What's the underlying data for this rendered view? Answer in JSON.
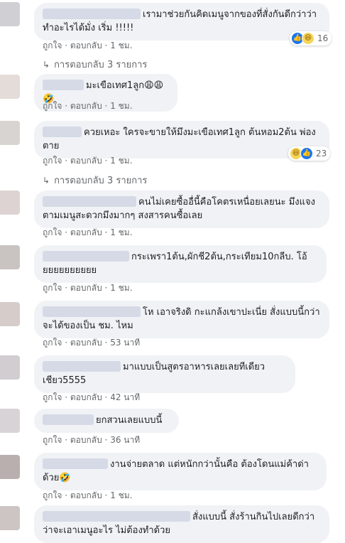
{
  "comments": [
    {
      "text": "เรามาช่วยกันคิดเมนูจากของที่สั่งกันดีกว่าว่าทำอะไรได้มั่ง เริ่ม !!!!!",
      "actions": {
        "like": "ถูกใจ",
        "reply": "ตอบกลับ",
        "time": "1 ชม."
      },
      "reactions": {
        "count": "16",
        "icons": [
          "like-icon",
          "haha-icon"
        ]
      },
      "replies_link": "การตอบกลับ 3 รายการ"
    },
    {
      "text": "มะเขือเทศ1ลูก",
      "emoji": "😩😩🤣",
      "actions": {
        "like": "ถูกใจ",
        "reply": "ตอบกลับ",
        "time": "1 ชม."
      }
    },
    {
      "text": "ควยเหอะ ใครจะขายให้มึงมะเขือเทศ1ลูก ต้นหอม2ต้น พ่องตาย",
      "actions": {
        "like": "ถูกใจ",
        "reply": "ตอบกลับ",
        "time": "1 ชม."
      },
      "reactions": {
        "count": "23",
        "icons": [
          "haha-icon",
          "like-icon"
        ]
      },
      "replies_link": "การตอบกลับ 3 รายการ"
    },
    {
      "text": "คนไม่เคยซื้ออื่นี้คือโคตรเหนื่อยเลยนะ มึงแจงตามเมนูสะดวกมึงมากๆ สงสารคนซื้อเลย",
      "actions": {
        "like": "ถูกใจ",
        "reply": "ตอบกลับ",
        "time": "1 ชม."
      }
    },
    {
      "text": "กระเพรา1ต้น,ผักชี2ต้น,กระเทียม10กลีบ. โอ้ยยยยยยยยยย",
      "actions": {
        "like": "ถูกใจ",
        "reply": "ตอบกลับ",
        "time": "1 ชม."
      }
    },
    {
      "text": "โห เอาจริงดิ กะแกล้งเขาปะเนี่ย สั่งแบบนี้กว่าจะได้ของเป็น ชม. ไหม",
      "actions": {
        "like": "ถูกใจ",
        "reply": "ตอบกลับ",
        "time": "53 นาที"
      }
    },
    {
      "text": "มาแบบเป็นสูตรอาหารเลยเลยทีเดียว เชียว5555",
      "actions": {
        "like": "ถูกใจ",
        "reply": "ตอบกลับ",
        "time": "42 นาที"
      }
    },
    {
      "text": "ยกสวนเลยแบบนี้",
      "actions": {
        "like": "ถูกใจ",
        "reply": "ตอบกลับ",
        "time": "36 นาที"
      }
    },
    {
      "text": "งานจ่ายตลาด แต่หนักกว่านั้นคือ ต้องโดนแม่ค้าด่าด้วย",
      "emoji": "🤣",
      "actions": {
        "like": "ถูกใจ",
        "reply": "ตอบกลับ",
        "time": "1 ชม."
      }
    },
    {
      "text": "สั่งแบบนี้ สั่งร้านกินไปเลยดีกว่า ว่าจะเอาเมนูอะไร ไม่ต้องทำด้วย",
      "actions": {}
    }
  ],
  "colors": {
    "bubble_bg": "#f0f2f5",
    "meta_text": "#65676b",
    "like_blue": "#1877f2",
    "haha_yellow": "#f7d558"
  }
}
